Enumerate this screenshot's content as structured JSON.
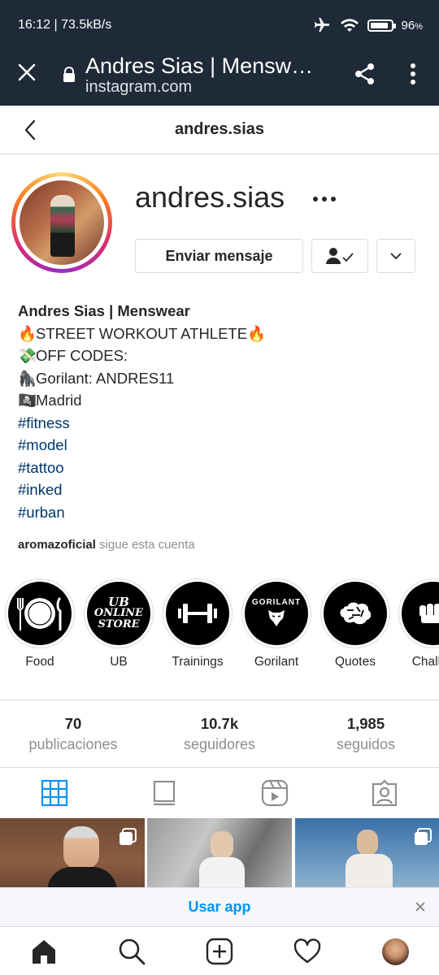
{
  "status_bar": {
    "time_speed": "16:12 | 73.5kB/s",
    "battery_percent": "96",
    "battery_suffix": "%",
    "battery_level": 0.96,
    "icons": [
      "airplane-icon",
      "wifi-icon",
      "battery-icon"
    ]
  },
  "browser": {
    "page_title": "Andres Sias | Menswear (@andres.sias) • Instagram photos and videos",
    "url": "instagram.com",
    "icons": [
      "close-icon",
      "lock-icon",
      "share-icon",
      "more-vertical-icon"
    ]
  },
  "ig_header": {
    "username": "andres.sias"
  },
  "profile": {
    "username": "andres.sias",
    "message_button": "Enviar mensaje",
    "full_name": "Andres Sias | Menswear",
    "bio_lines": [
      {
        "emoji": "🔥",
        "text": "STREET WORKOUT ATHLETE",
        "emoji_after": "🔥"
      },
      {
        "emoji": "💸",
        "text": "OFF CODES:"
      },
      {
        "emoji": "🦍",
        "text": "Gorilant: ANDRES11"
      },
      {
        "emoji": "🏴‍☠️",
        "text": "Madrid"
      }
    ],
    "hashtags": [
      "#fitness",
      "#model",
      "#tattoo",
      "#inked",
      "#urban"
    ],
    "followed_by_user": "aromazoficial",
    "followed_by_text": " sigue esta cuenta"
  },
  "highlights": [
    {
      "label": "Food",
      "icon": "plate-cutlery-icon"
    },
    {
      "label": "UB",
      "icon": "ub-logo-icon",
      "logo_text": [
        "UB",
        "ONLINE",
        "STORE"
      ]
    },
    {
      "label": "Trainings",
      "icon": "dumbbell-icon"
    },
    {
      "label": "Gorilant",
      "icon": "gorilla-logo-icon",
      "logo_text": [
        "GORILANT"
      ]
    },
    {
      "label": "Quotes",
      "icon": "brain-icon"
    },
    {
      "label": "Challen",
      "icon": "fist-icon"
    }
  ],
  "stats": [
    {
      "value": "70",
      "label": "publicaciones"
    },
    {
      "value": "10.7k",
      "label": "seguidores"
    },
    {
      "value": "1,985",
      "label": "seguidos"
    }
  ],
  "tabs": [
    {
      "name": "grid",
      "icon": "grid-icon",
      "active": true
    },
    {
      "name": "feed",
      "icon": "feed-icon",
      "active": false
    },
    {
      "name": "reels",
      "icon": "reels-icon",
      "active": false
    },
    {
      "name": "tagged",
      "icon": "tagged-icon",
      "active": false
    }
  ],
  "use_app_banner": {
    "text": "Usar app"
  },
  "bottom_nav": [
    "home-icon",
    "search-icon",
    "new-post-icon",
    "activity-heart-icon",
    "profile-avatar"
  ],
  "colors": {
    "header_bg": "#1f2a38",
    "link": "#00376b",
    "accent_blue": "#0095f6",
    "muted": "#8e8e8e"
  }
}
